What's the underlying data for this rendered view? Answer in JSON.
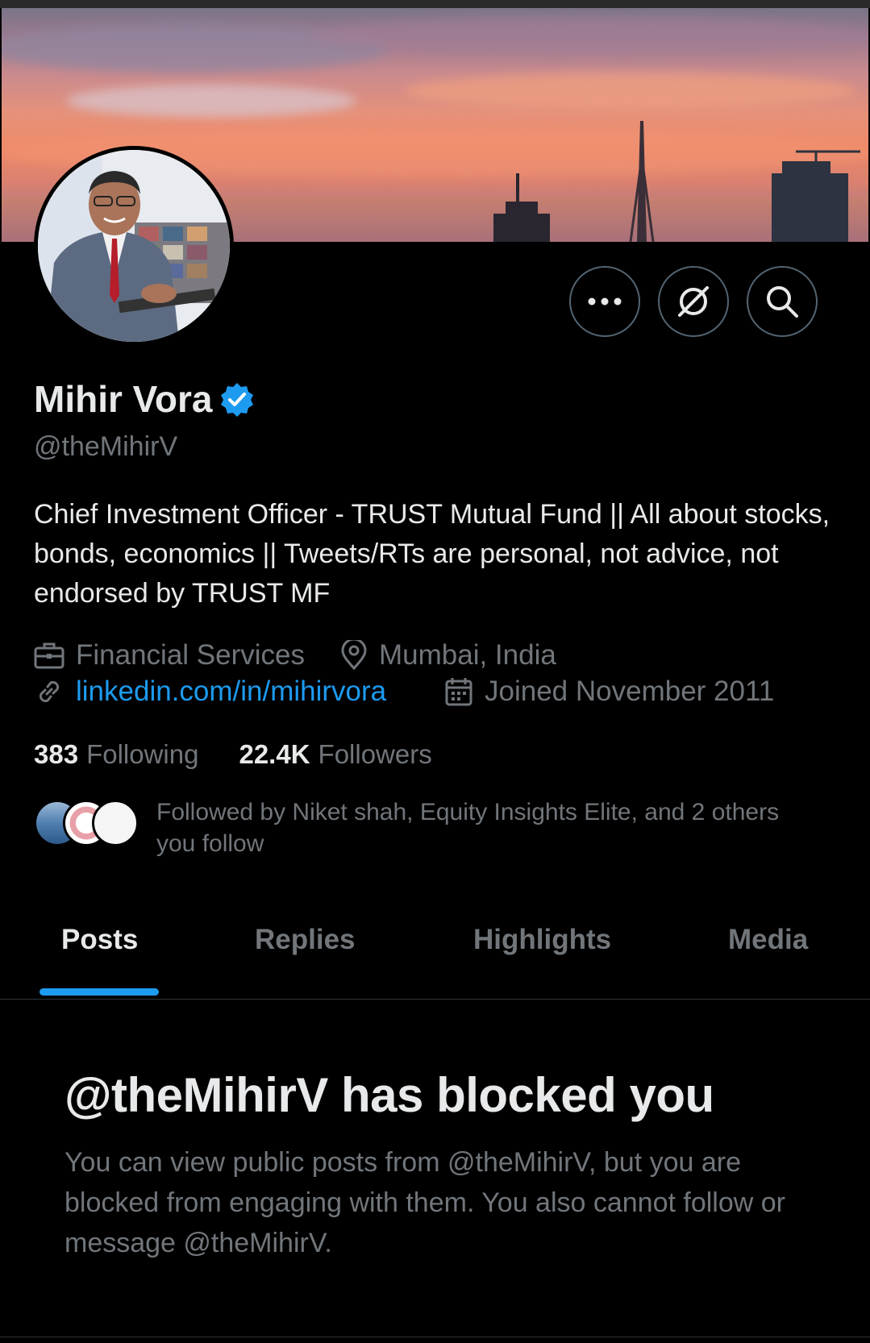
{
  "profile": {
    "name": "Mihir Vora",
    "handle": "@theMihirV",
    "bio": "Chief Investment Officer - TRUST Mutual Fund || All about stocks, bonds, economics || Tweets/RTs are personal, not advice, not endorsed by TRUST MF",
    "category": "Financial Services",
    "location": "Mumbai, India",
    "website": "linkedin.com/in/mihirvora",
    "joined": "Joined November 2011"
  },
  "stats": {
    "following_count": "383",
    "following_label": "Following",
    "followers_count": "22.4K",
    "followers_label": "Followers"
  },
  "followed_by": {
    "text": "Followed by Niket shah, Equity Insights Elite, and 2 others you follow"
  },
  "actions": {
    "more_icon": "more-horizontal-icon",
    "grok_icon": "grok-icon",
    "search_icon": "search-icon"
  },
  "tabs": [
    {
      "label": "Posts",
      "active": true
    },
    {
      "label": "Replies",
      "active": false
    },
    {
      "label": "Highlights",
      "active": false
    },
    {
      "label": "Media",
      "active": false
    }
  ],
  "blocked": {
    "title": "@theMihirV has blocked you",
    "description": "You can view public posts from @theMihirV, but you are blocked from engaging with them. You also cannot follow or message @theMihirV."
  },
  "colors": {
    "background": "#000000",
    "accent": "#1d9bf0",
    "text_primary": "#e7e9ea",
    "text_secondary": "#71767b",
    "border": "#2f3336"
  }
}
